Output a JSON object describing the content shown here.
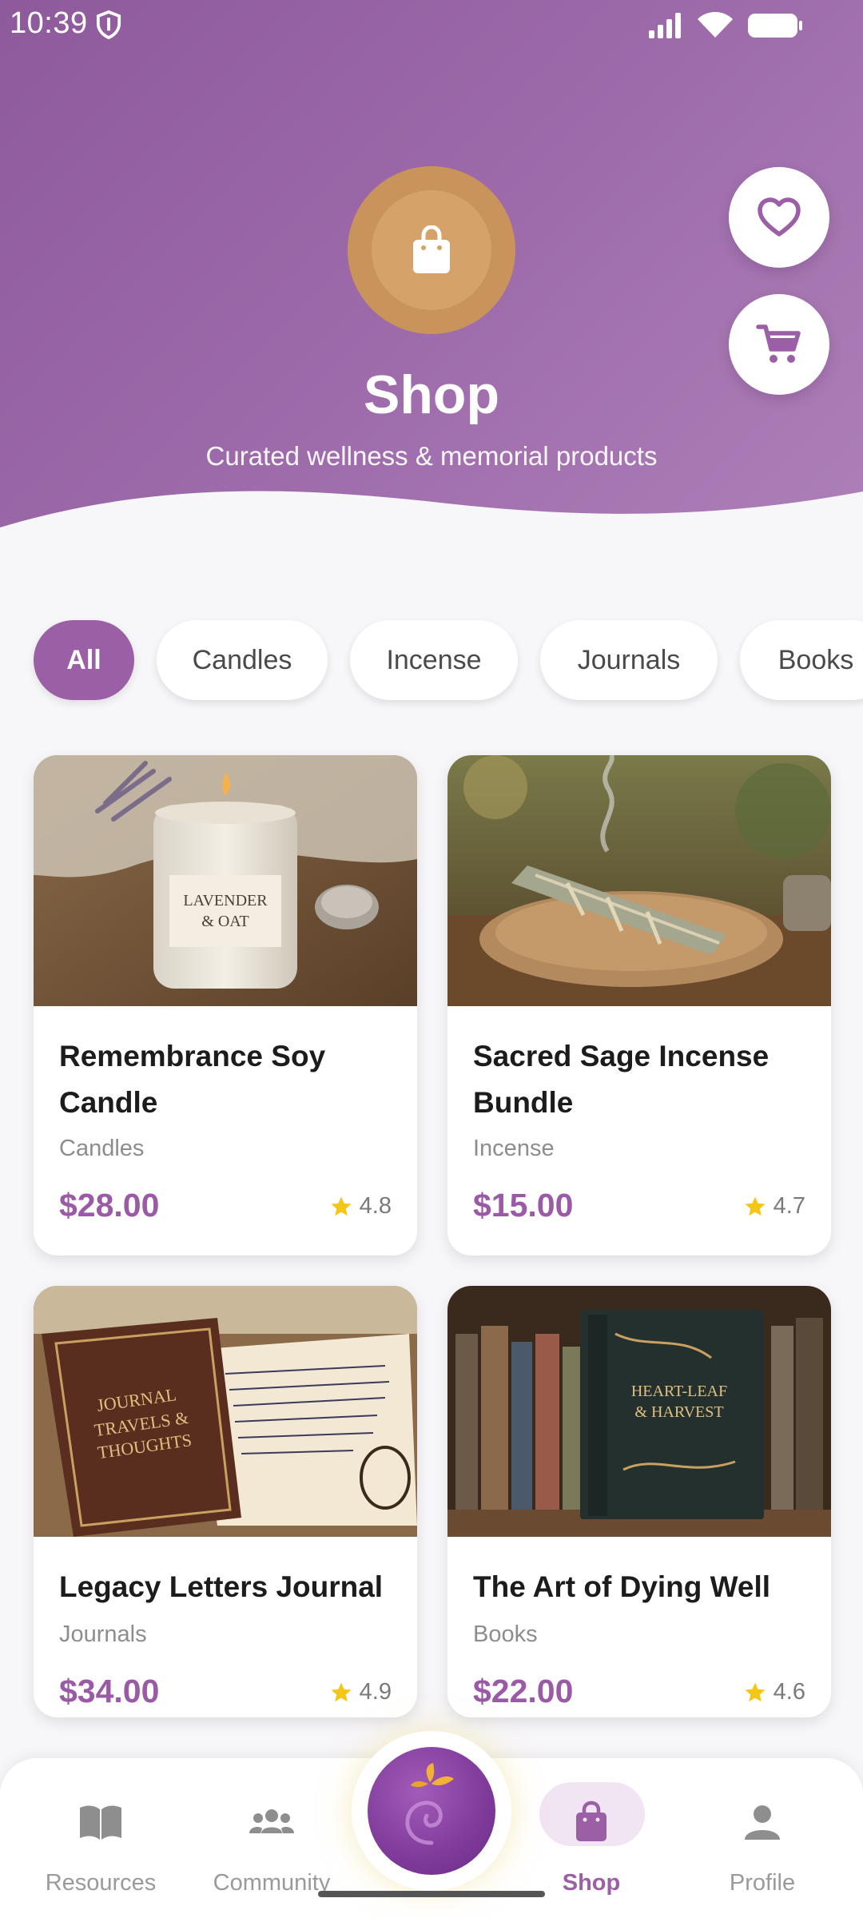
{
  "status_bar": {
    "time": "10:39"
  },
  "header": {
    "title": "Shop",
    "subtitle": "Curated wellness & memorial products"
  },
  "categories": [
    {
      "label": "All",
      "active": true
    },
    {
      "label": "Candles",
      "active": false
    },
    {
      "label": "Incense",
      "active": false
    },
    {
      "label": "Journals",
      "active": false
    },
    {
      "label": "Books",
      "active": false
    }
  ],
  "products": [
    {
      "name": "Remembrance Soy Candle",
      "category": "Candles",
      "price": "$28.00",
      "rating": "4.8",
      "image_text": [
        "LAVENDER",
        "& OAT"
      ]
    },
    {
      "name": "Sacred Sage Incense Bundle",
      "category": "Incense",
      "price": "$15.00",
      "rating": "4.7"
    },
    {
      "name": "Legacy Letters Journal",
      "category": "Journals",
      "price": "$34.00",
      "rating": "4.9",
      "image_text": [
        "JOURNAL",
        "TRAVELS &",
        "THOUGHTS"
      ]
    },
    {
      "name": "The Art of Dying Well",
      "category": "Books",
      "price": "$22.00",
      "rating": "4.6",
      "image_text": [
        "HEART-LEAF",
        "& HARVEST"
      ]
    }
  ],
  "bottom_nav": [
    {
      "label": "Resources",
      "icon": "book-icon",
      "active": false
    },
    {
      "label": "Community",
      "icon": "people-icon",
      "active": false
    },
    {
      "label": "Shop",
      "icon": "bag-icon",
      "active": true
    },
    {
      "label": "Profile",
      "icon": "person-icon",
      "active": false
    }
  ],
  "colors": {
    "accent": "#9b5fa6",
    "header_start": "#8e5a9c",
    "header_end": "#ad7fb8",
    "badge": "#c9935c",
    "star": "#f5c518"
  }
}
